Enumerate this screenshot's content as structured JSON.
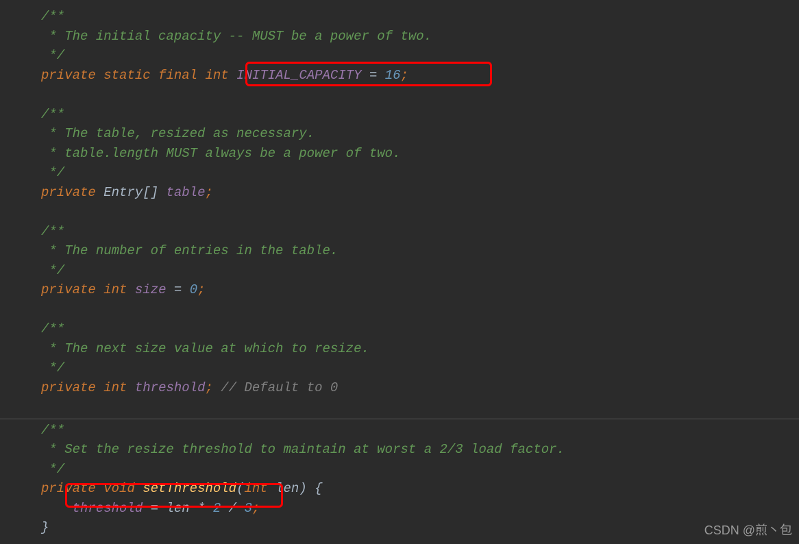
{
  "block1": {
    "l1": "/**",
    "l2": " * The initial capacity -- MUST be a power of two.",
    "l3": " */"
  },
  "decl1": {
    "kw1": "private",
    "kw2": "static",
    "kw3": "final",
    "kw4": "int",
    "name": "INITIAL_CAPACITY",
    "eq": " = ",
    "val": "16",
    "semi": ";"
  },
  "block2": {
    "l1": "/**",
    "l2": " * The table, resized as necessary.",
    "l3": " * table.length MUST always be a power of two.",
    "l4": " */"
  },
  "decl2": {
    "kw1": "private",
    "type": "Entry",
    "brackets": "[] ",
    "name": "table",
    "semi": ";"
  },
  "block3": {
    "l1": "/**",
    "l2": " * The number of entries in the table.",
    "l3": " */"
  },
  "decl3": {
    "kw1": "private",
    "kw2": "int",
    "name": "size",
    "eq": " = ",
    "val": "0",
    "semi": ";"
  },
  "block4": {
    "l1": "/**",
    "l2": " * The next size value at which to resize.",
    "l3": " */"
  },
  "decl4": {
    "kw1": "private",
    "kw2": "int",
    "name": "threshold",
    "semi": "; ",
    "comment": "// Default to 0"
  },
  "block5": {
    "l1": "/**",
    "l2": " * Set the resize threshold to maintain at worst a 2/3 load factor.",
    "l3": " */"
  },
  "method": {
    "kw1": "private",
    "kw2": "void",
    "name": "setThreshold",
    "paren1": "(",
    "ptype": "int",
    "pname": " len",
    "paren2": ") {",
    "body_name": "threshold",
    "body_eq": " = len * ",
    "body_n1": "2",
    "body_div": " / ",
    "body_n2": "3",
    "body_semi": ";",
    "close": "}"
  },
  "watermark": "CSDN @煎丶包"
}
